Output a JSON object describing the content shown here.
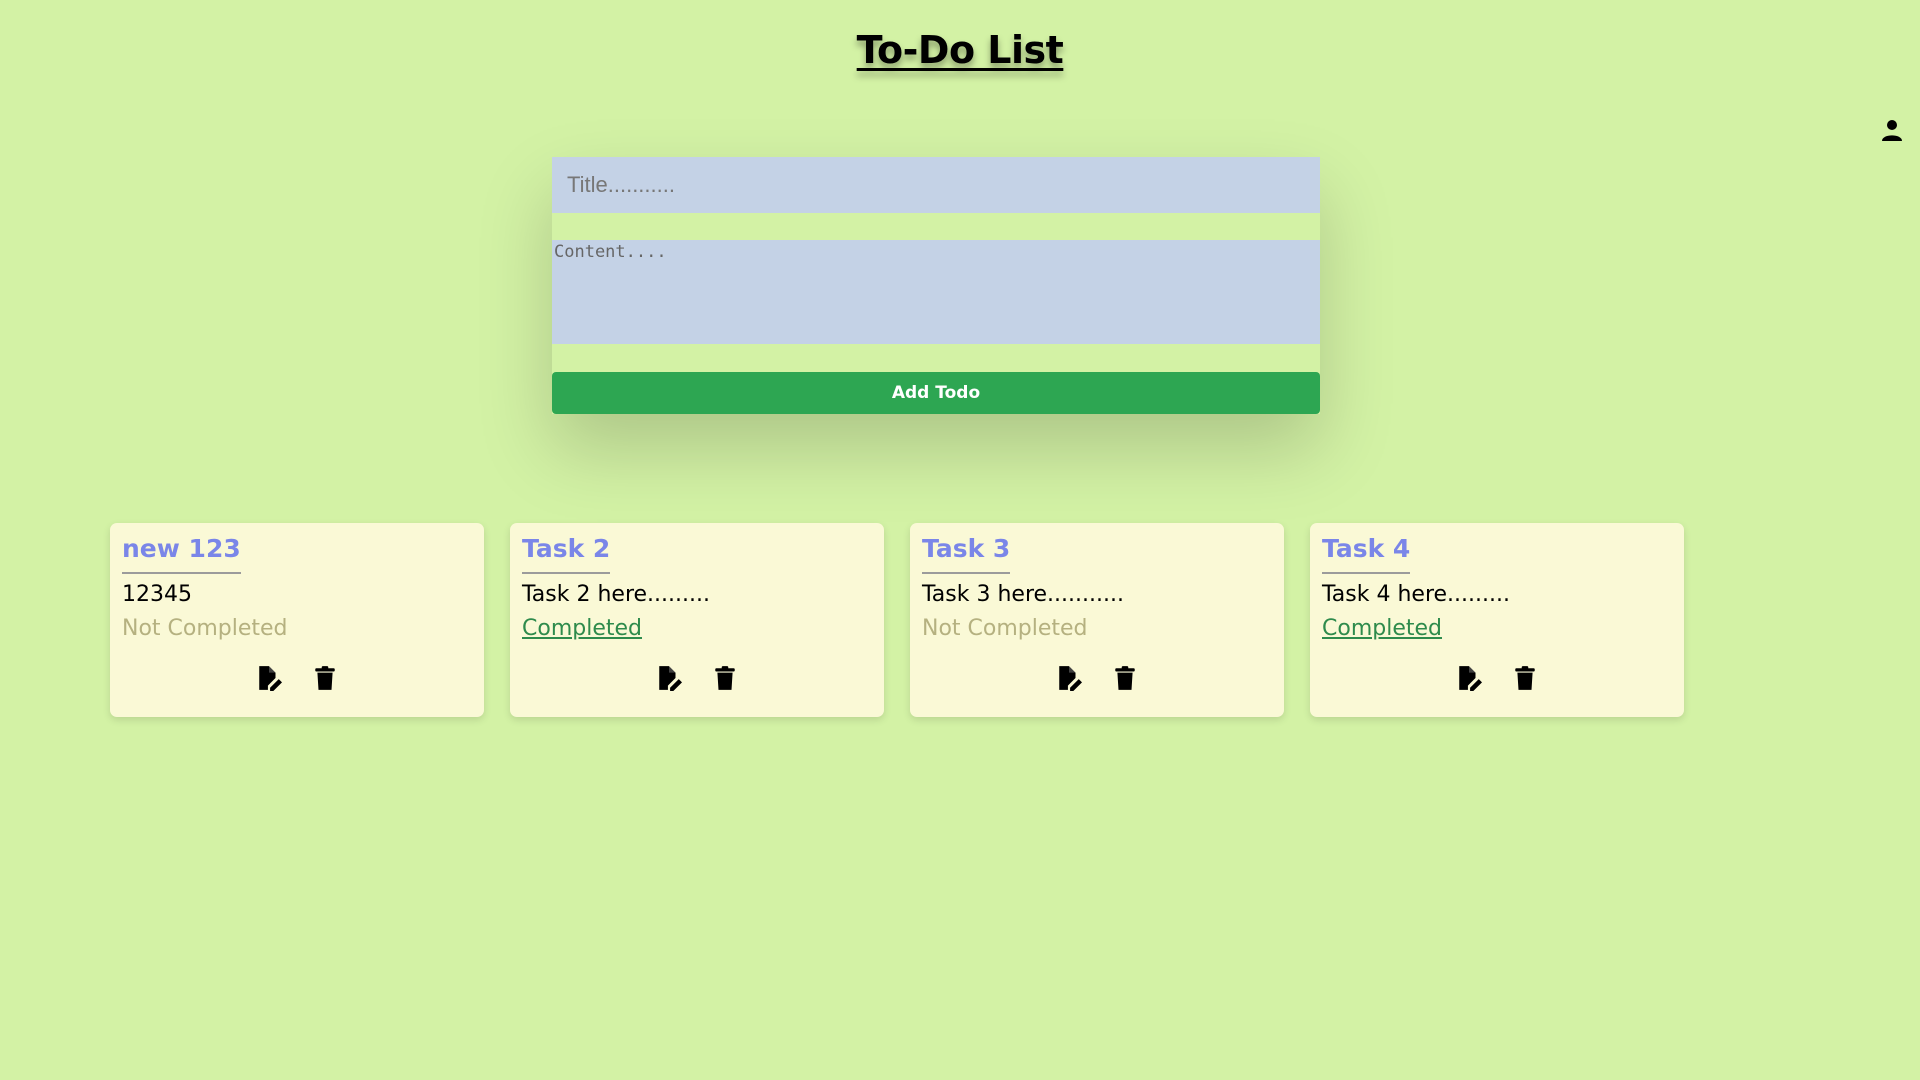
{
  "header": {
    "title": "To-Do List"
  },
  "form": {
    "title_placeholder": "Title...........",
    "content_placeholder": "Content....",
    "add_label": "Add Todo",
    "add_color": "#2da652"
  },
  "icons": {
    "user": "user-icon",
    "edit": "edit-icon",
    "delete": "trash-icon"
  },
  "todos": [
    {
      "title": "new 123",
      "content": "12345",
      "status": "Not Completed",
      "completed": false
    },
    {
      "title": "Task 2",
      "content": "Task 2 here.........",
      "status": "Completed",
      "completed": true
    },
    {
      "title": "Task 3",
      "content": "Task 3 here...........",
      "status": "Not Completed",
      "completed": false
    },
    {
      "title": "Task 4",
      "content": "Task 4 here.........",
      "status": "Completed",
      "completed": true
    }
  ]
}
